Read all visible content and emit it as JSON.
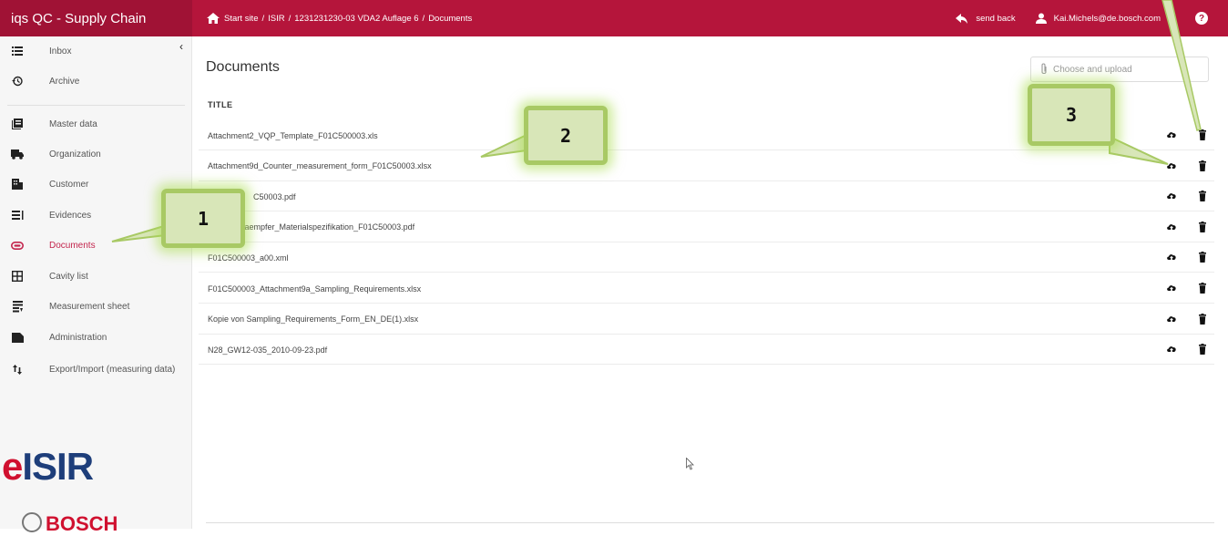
{
  "app": {
    "title": "iqs QC - Supply Chain"
  },
  "breadcrumb": [
    "Start site",
    "/",
    "ISIR",
    "/",
    "1231231230-03 VDA2 Auflage 6",
    "/",
    "Documents"
  ],
  "header": {
    "send_back": "send back",
    "user": "Kai.Michels@de.bosch.com",
    "help": "?"
  },
  "sidebar": {
    "items": [
      {
        "label": "Inbox",
        "icon": "list-icon"
      },
      {
        "label": "Archive",
        "icon": "history-icon"
      },
      {
        "label": "Master data",
        "icon": "book-icon"
      },
      {
        "label": "Organization",
        "icon": "truck-icon"
      },
      {
        "label": "Customer",
        "icon": "building-icon"
      },
      {
        "label": "Evidences",
        "icon": "list-check-icon"
      },
      {
        "label": "Documents",
        "icon": "paperclip-icon",
        "active": true
      },
      {
        "label": "Cavity list",
        "icon": "grid-icon"
      },
      {
        "label": "Measurement sheet",
        "icon": "sheet-icon"
      },
      {
        "label": "Administration",
        "icon": "folder-icon"
      },
      {
        "label": "Export/Import (measuring data)",
        "icon": "sort-icon"
      }
    ],
    "collapse": "‹"
  },
  "logos": {
    "eisir_e": "e",
    "eisir_rest": "ISIR",
    "bosch": "BOSCH"
  },
  "main": {
    "title": "Documents",
    "upload_placeholder": "Choose and upload",
    "column_title": "TITLE",
    "documents": [
      "Attachment2_VQP_Template_F01C500003.xls",
      "Attachment9d_Counter_measurement_form_F01C50003.xlsx",
      "C50003.pdf",
      "Daempfer_Materialspezifikation_F01C50003.pdf",
      "F01C500003_a00.xml",
      "F01C500003_Attachment9a_Sampling_Requirements.xlsx",
      "Kopie von Sampling_Requirements_Form_EN_DE(1).xlsx",
      "N28_GW12-035_2010-09-23.pdf"
    ]
  },
  "callouts": [
    "1",
    "2",
    "3"
  ],
  "colors": {
    "brand": "#b5153b",
    "active": "#c3254d",
    "callout_fill": "#d8e6b8",
    "callout_border": "#a8c964"
  }
}
